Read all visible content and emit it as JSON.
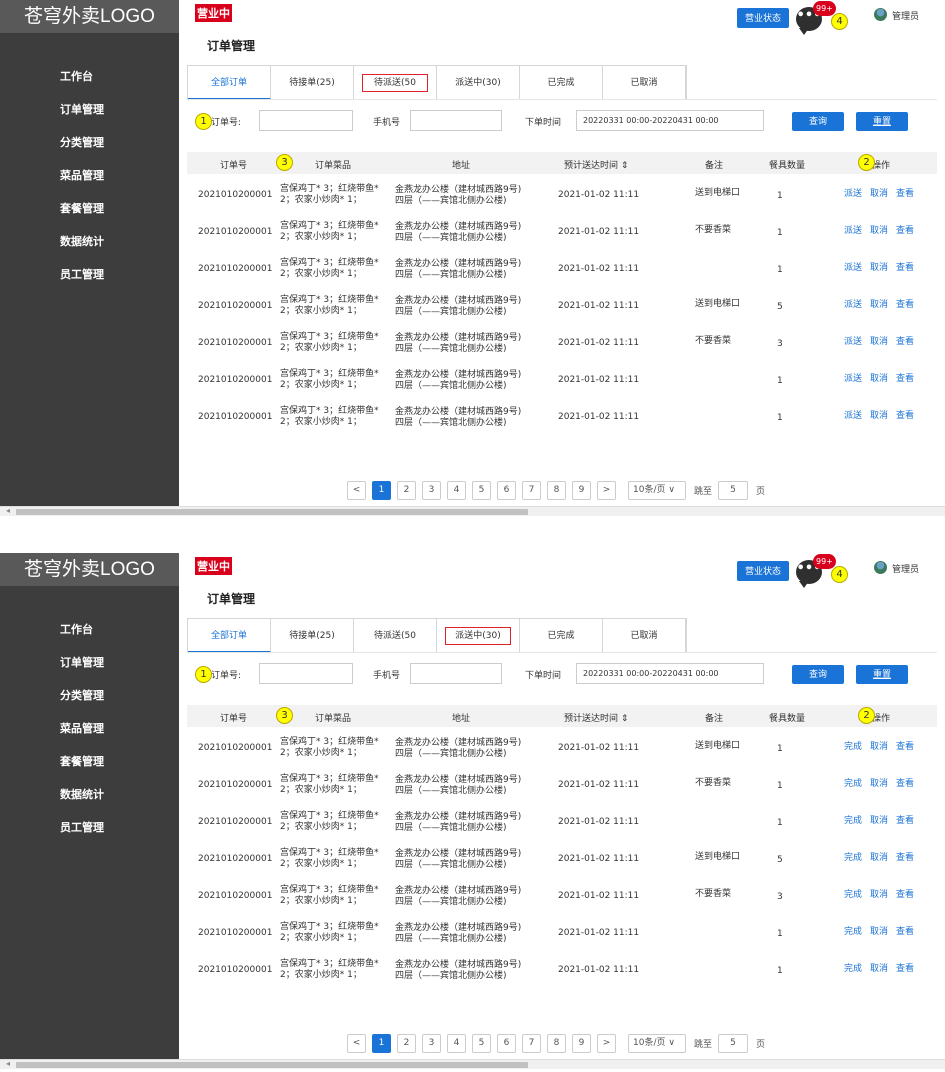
{
  "logo": "苍穹外卖LOGO",
  "status_flag": "营业中",
  "page_title": "订单管理",
  "business_button": "营业状态",
  "message_icon": "•••",
  "message_badge": "99+",
  "user_name": "管理员",
  "nav": [
    "工作台",
    "订单管理",
    "分类管理",
    "菜品管理",
    "套餐管理",
    "数据统计",
    "员工管理"
  ],
  "tabs": [
    "全部订单",
    "待接单(25)",
    "待派送(50",
    "派送中(30)",
    "已完成",
    "已取消"
  ],
  "filters": {
    "order_no_label": "订单号:",
    "phone_label": "手机号",
    "time_label": "下单时间",
    "time_value": "20220331 00:00-20220431 00:00",
    "query": "查询",
    "reset": "重置"
  },
  "columns": {
    "order_no": "订单号",
    "dishes": "订单菜品",
    "address": "地址",
    "eta": "预计送达时间 ⇕",
    "note": "备注",
    "tableware": "餐具数量",
    "ops": "操作"
  },
  "markers": [
    "1",
    "2",
    "3",
    "4"
  ],
  "row_common": {
    "order_no": "2021010200001",
    "dish1": "宫保鸡丁* 3；红烧带鱼*",
    "dish2": "2；农家小炒肉* 1；",
    "addr1": "金燕龙办公楼（建材城西路9号)",
    "addr2": "四层（——宾馆北侧办公楼)",
    "eta": "2021-01-02 11:11"
  },
  "rows": [
    {
      "note": "送到电梯口",
      "qty": "1"
    },
    {
      "note": "不要香菜",
      "qty": "1"
    },
    {
      "note": "",
      "qty": "1"
    },
    {
      "note": "送到电梯口",
      "qty": "5"
    },
    {
      "note": "不要香菜",
      "qty": "3"
    },
    {
      "note": "",
      "qty": "1"
    },
    {
      "note": "",
      "qty": "1"
    }
  ],
  "frames": [
    {
      "active_tab": 0,
      "boxed_tab": 2,
      "action1": "派送",
      "action2": "取消",
      "action3": "查看"
    },
    {
      "active_tab": 0,
      "boxed_tab": 3,
      "action1": "完成",
      "action2": "取消",
      "action3": "查看"
    }
  ],
  "pager": {
    "prev": "<",
    "next": ">",
    "pages": [
      "1",
      "2",
      "3",
      "4",
      "5",
      "6",
      "7",
      "8",
      "9"
    ],
    "current": "1",
    "page_size": "10条/页 ∨",
    "jump_label": "跳至",
    "jump_value": "5",
    "page_suffix": "页"
  },
  "scroll_arrow": "◂"
}
